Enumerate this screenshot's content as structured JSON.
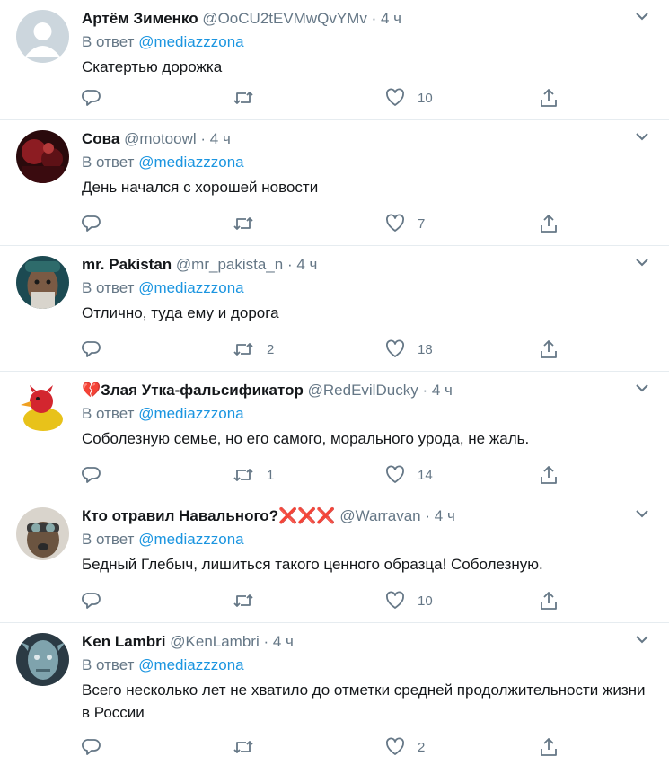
{
  "reply_prefix": "В ответ",
  "reply_mention": "@mediazzzona",
  "sep": "·",
  "colors": {
    "text": "#14171a",
    "secondary": "#657786",
    "link": "#1b95e0",
    "border": "#e6ecf0",
    "accent_red": "#d72c3a"
  },
  "icons": {
    "reply": "reply-icon",
    "retweet": "retweet-icon",
    "like": "heart-icon",
    "share": "share-icon",
    "menu": "chevron-down-icon"
  },
  "tweets": [
    {
      "name": "Артём Зименко",
      "handle": "@OoCU2tEVMwQvYMv",
      "time": "4 ч",
      "text": "Скатертью дорожка",
      "retweets": "",
      "likes": "10"
    },
    {
      "name": "Сова",
      "handle": "@motoowl",
      "time": "4 ч",
      "text": "День начался с хорошей новости",
      "retweets": "",
      "likes": "7"
    },
    {
      "name": "mr. Pakistan",
      "handle": "@mr_pakista_n",
      "time": "4 ч",
      "text": "Отлично, туда ему и дорога",
      "retweets": "2",
      "likes": "18"
    },
    {
      "name_emoji": "💔",
      "name": "Злая Утка-фальсификатор",
      "handle": "@RedEvilDucky",
      "time": "4 ч",
      "text": "Соболезную семье, но его самого, морального урода, не жаль.",
      "retweets": "1",
      "likes": "14"
    },
    {
      "name": "Кто отравил Навального?",
      "name_suffix": "❌❌❌",
      "handle": "@Warravan",
      "time": "4 ч",
      "text": "Бедный Глебыч, лишиться такого ценного образца! Соболезную.",
      "retweets": "",
      "likes": "10"
    },
    {
      "name": "Ken Lambri",
      "handle": "@KenLambri",
      "time": "4 ч",
      "text": "Всего несколько лет не хватило до отметки средней продолжительности жизни в России",
      "retweets": "",
      "likes": "2"
    }
  ]
}
